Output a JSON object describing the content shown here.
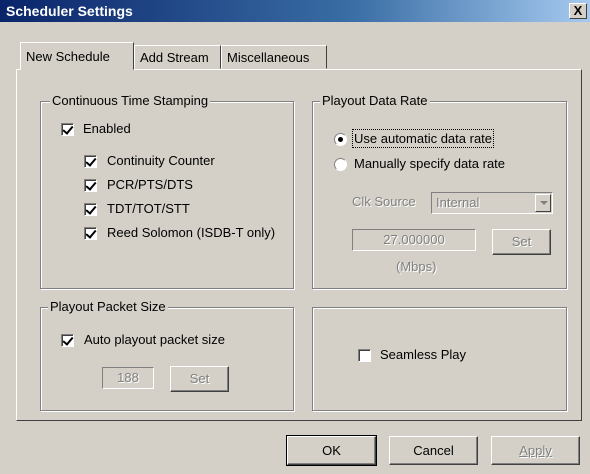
{
  "window": {
    "title": "Scheduler Settings",
    "close_label": "X"
  },
  "tabs": [
    {
      "label": "New Schedule",
      "active": true
    },
    {
      "label": "Add Stream",
      "active": false
    },
    {
      "label": "Miscellaneous",
      "active": false
    }
  ],
  "continuous_time_stamping": {
    "legend": "Continuous Time Stamping",
    "enabled": {
      "label": "Enabled",
      "checked": true
    },
    "options": [
      {
        "label": "Continuity Counter",
        "checked": true
      },
      {
        "label": "PCR/PTS/DTS",
        "checked": true
      },
      {
        "label": "TDT/TOT/STT",
        "checked": true
      },
      {
        "label": "Reed Solomon (ISDB-T only)",
        "checked": true
      }
    ]
  },
  "playout_data_rate": {
    "legend": "Playout Data Rate",
    "auto_label": "Use automatic data rate",
    "manual_label": "Manually specify data rate",
    "selected": "auto",
    "clk_source_label": "Clk Source",
    "clk_source_value": "Internal",
    "rate_value": "27.000000",
    "rate_unit": "(Mbps)",
    "set_label": "Set"
  },
  "playout_packet_size": {
    "legend": "Playout Packet Size",
    "auto_label": "Auto playout packet size",
    "auto_checked": true,
    "size_value": "188",
    "set_label": "Set"
  },
  "seamless": {
    "label": "Seamless Play",
    "checked": false
  },
  "buttons": {
    "ok": "OK",
    "cancel": "Cancel",
    "apply": "Apply"
  }
}
